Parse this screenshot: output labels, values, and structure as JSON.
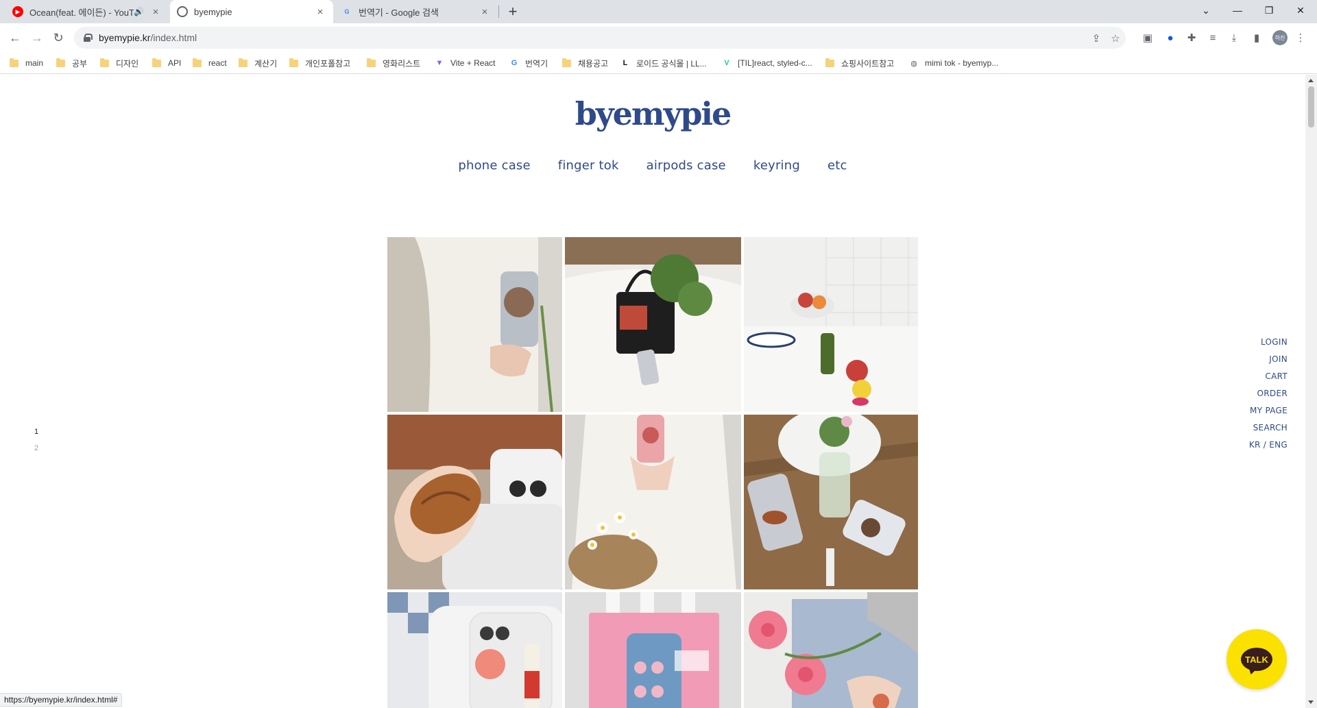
{
  "browser": {
    "tabs": [
      {
        "title": "Ocean(feat. 에이든) - YouTube",
        "favicon": "youtube-icon"
      },
      {
        "title": "byemypie",
        "favicon": "globe-icon"
      },
      {
        "title": "번역기 - Google 검색",
        "favicon": "google-icon"
      }
    ],
    "url_host": "byemypie.kr",
    "url_path": "/index.html",
    "bookmarks": [
      {
        "label": "main",
        "icon": "folder"
      },
      {
        "label": "공부",
        "icon": "folder"
      },
      {
        "label": "디자인",
        "icon": "folder"
      },
      {
        "label": "API",
        "icon": "folder"
      },
      {
        "label": "react",
        "icon": "folder"
      },
      {
        "label": "계산기",
        "icon": "folder"
      },
      {
        "label": "개인포폴참고",
        "icon": "folder"
      },
      {
        "label": "영화리스트",
        "icon": "folder"
      },
      {
        "label": "Vite + React",
        "icon": "vite"
      },
      {
        "label": "번역기",
        "icon": "google"
      },
      {
        "label": "채용공고",
        "icon": "folder"
      },
      {
        "label": "로이드 공식몰 | LL...",
        "icon": "lloyd"
      },
      {
        "label": "[TIL]react, styled-c...",
        "icon": "velog"
      },
      {
        "label": "쇼핑사이트참고",
        "icon": "folder"
      },
      {
        "label": "mimi tok - byemyp...",
        "icon": "globe"
      }
    ],
    "status_url": "https://byemypie.kr/index.html#",
    "profile_initials": "하진"
  },
  "site": {
    "logo": "byemypie",
    "categories": [
      "phone case",
      "finger tok",
      "airpods case",
      "keyring",
      "etc"
    ],
    "pager": [
      "1",
      "2"
    ],
    "side_menu": [
      "LOGIN",
      "JOIN",
      "CART",
      "ORDER",
      "MY PAGE",
      "SEARCH",
      "KR / ENG"
    ],
    "talk_label": "TALK",
    "brand_color": "#2f4a8a",
    "talk_color": "#fae100"
  }
}
